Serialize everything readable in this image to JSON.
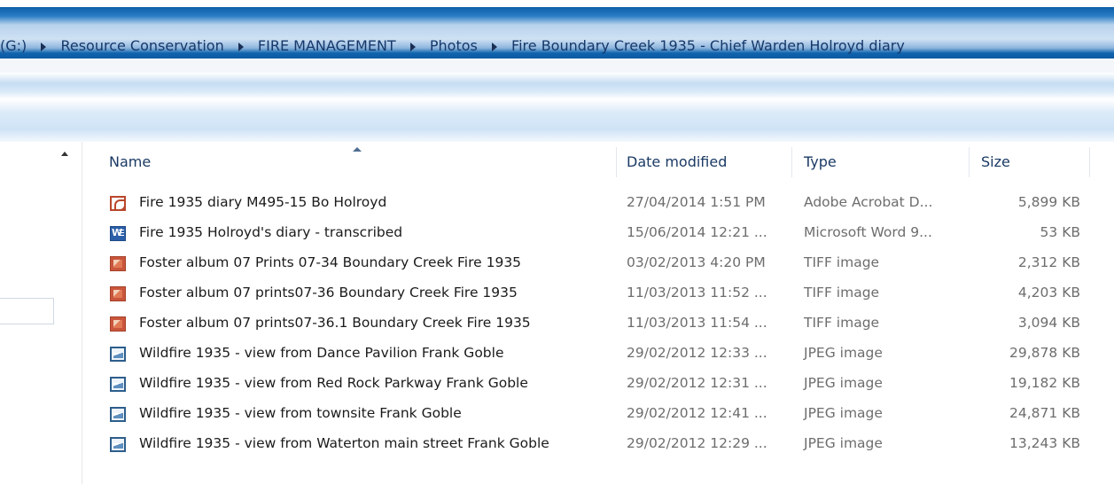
{
  "breadcrumb": [
    "(G:)",
    "Resource Conservation",
    "FIRE MANAGEMENT",
    "Photos",
    "Fire Boundary Creek 1935 - Chief Warden Holroyd diary"
  ],
  "columns": {
    "name": "Name",
    "date": "Date modified",
    "type": "Type",
    "size": "Size"
  },
  "files": [
    {
      "name": "Fire 1935  diary M495-15 Bo Holroyd",
      "date": "27/04/2014 1:51 PM",
      "type": "Adobe Acrobat D...",
      "size": "5,899 KB",
      "icon": "pdf-icon"
    },
    {
      "name": "Fire 1935 Holroyd's diary - transcribed",
      "date": "15/06/2014 12:21 ...",
      "type": "Microsoft Word 9...",
      "size": "53 KB",
      "icon": "word-icon"
    },
    {
      "name": "Foster album 07 Prints 07-34 Boundary Creek Fire 1935",
      "date": "03/02/2013 4:20 PM",
      "type": "TIFF image",
      "size": "2,312 KB",
      "icon": "tiff-icon"
    },
    {
      "name": "Foster album 07 prints07-36 Boundary Creek Fire 1935",
      "date": "11/03/2013 11:52 ...",
      "type": "TIFF image",
      "size": "4,203 KB",
      "icon": "tiff-icon"
    },
    {
      "name": "Foster album 07 prints07-36.1 Boundary Creek Fire 1935",
      "date": "11/03/2013 11:54 ...",
      "type": "TIFF image",
      "size": "3,094 KB",
      "icon": "tiff-icon"
    },
    {
      "name": "Wildfire 1935 - view from Dance Pavilion Frank Goble",
      "date": "29/02/2012 12:33 ...",
      "type": "JPEG image",
      "size": "29,878 KB",
      "icon": "jpeg-icon"
    },
    {
      "name": "Wildfire 1935 - view from Red Rock Parkway Frank Goble",
      "date": "29/02/2012 12:31 ...",
      "type": "JPEG image",
      "size": "19,182 KB",
      "icon": "jpeg-icon"
    },
    {
      "name": "Wildfire 1935 - view from townsite Frank Goble",
      "date": "29/02/2012 12:41 ...",
      "type": "JPEG image",
      "size": "24,871 KB",
      "icon": "jpeg-icon"
    },
    {
      "name": "Wildfire 1935 - view from Waterton main street Frank Goble",
      "date": "29/02/2012 12:29 ...",
      "type": "JPEG image",
      "size": "13,243 KB",
      "icon": "jpeg-icon"
    }
  ]
}
